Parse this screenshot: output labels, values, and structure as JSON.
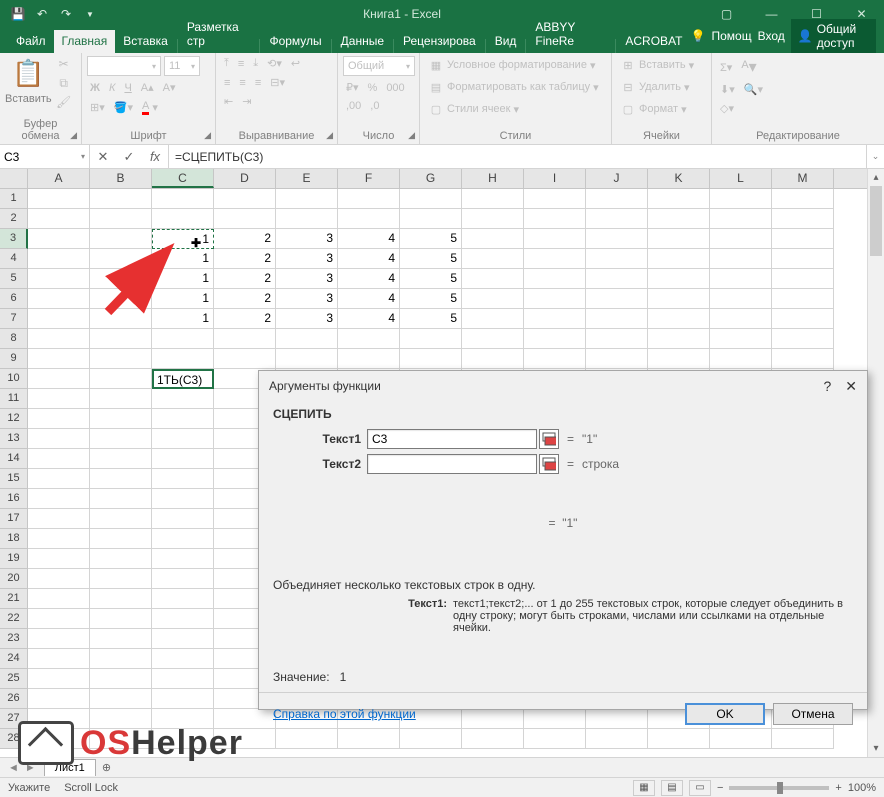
{
  "titlebar": {
    "title": "Книга1 - Excel"
  },
  "tabs": {
    "file": "Файл",
    "home": "Главная",
    "insert": "Вставка",
    "layout": "Разметка стр",
    "formulas": "Формулы",
    "data": "Данные",
    "review": "Рецензирова",
    "view": "Вид",
    "abbyy": "ABBYY FineRe",
    "acrobat": "ACROBAT",
    "tell": "Помощ",
    "signin": "Вход",
    "share": "Общий доступ"
  },
  "ribbon": {
    "clipboard": {
      "paste": "Вставить",
      "label": "Буфер обмена"
    },
    "font": {
      "size": "11",
      "label": "Шрифт",
      "b": "Ж",
      "i": "К",
      "u": "Ч"
    },
    "align": {
      "label": "Выравнивание"
    },
    "number": {
      "format": "Общий",
      "label": "Число"
    },
    "styles": {
      "cond": "Условное форматирование",
      "table": "Форматировать как таблицу",
      "cell": "Стили ячеек",
      "label": "Стили"
    },
    "cells": {
      "insert": "Вставить",
      "delete": "Удалить",
      "format": "Формат",
      "label": "Ячейки"
    },
    "editing": {
      "label": "Редактирование"
    }
  },
  "namebox": "C3",
  "formula": "=СЦЕПИТЬ(C3)",
  "cols": [
    "A",
    "B",
    "C",
    "D",
    "E",
    "F",
    "G",
    "H",
    "I",
    "J",
    "K",
    "L",
    "M"
  ],
  "gridC10": "1ТЬ(C3)",
  "datarows": [
    {
      "c": "1",
      "d": "2",
      "e": "3",
      "f": "4",
      "g": "5"
    },
    {
      "c": "1",
      "d": "2",
      "e": "3",
      "f": "4",
      "g": "5"
    },
    {
      "c": "1",
      "d": "2",
      "e": "3",
      "f": "4",
      "g": "5"
    },
    {
      "c": "1",
      "d": "2",
      "e": "3",
      "f": "4",
      "g": "5"
    },
    {
      "c": "1",
      "d": "2",
      "e": "3",
      "f": "4",
      "g": "5"
    }
  ],
  "dialog": {
    "title": "Аргументы функции",
    "func": "СЦЕПИТЬ",
    "arg1_label": "Текст1",
    "arg1_value": "C3",
    "arg1_result": "\"1\"",
    "arg2_label": "Текст2",
    "arg2_result": "строка",
    "midresult": "\"1\"",
    "desc": "Объединяет несколько текстовых строк в одну.",
    "argname": "Текст1:",
    "argdesc": "текст1;текст2;... от 1 до 255 текстовых строк, которые следует объединить в одну строку; могут быть строками, числами или ссылками на отдельные ячейки.",
    "result_label": "Значение:",
    "result_value": "1",
    "help": "Справка по этой функции",
    "ok": "OK",
    "cancel": "Отмена"
  },
  "sheet": {
    "name": "Лист1"
  },
  "status": {
    "mode": "Укажите",
    "scroll": "Scroll Lock",
    "zoom": "100%"
  },
  "watermark": {
    "os": "OS",
    "helper": "Helper"
  }
}
